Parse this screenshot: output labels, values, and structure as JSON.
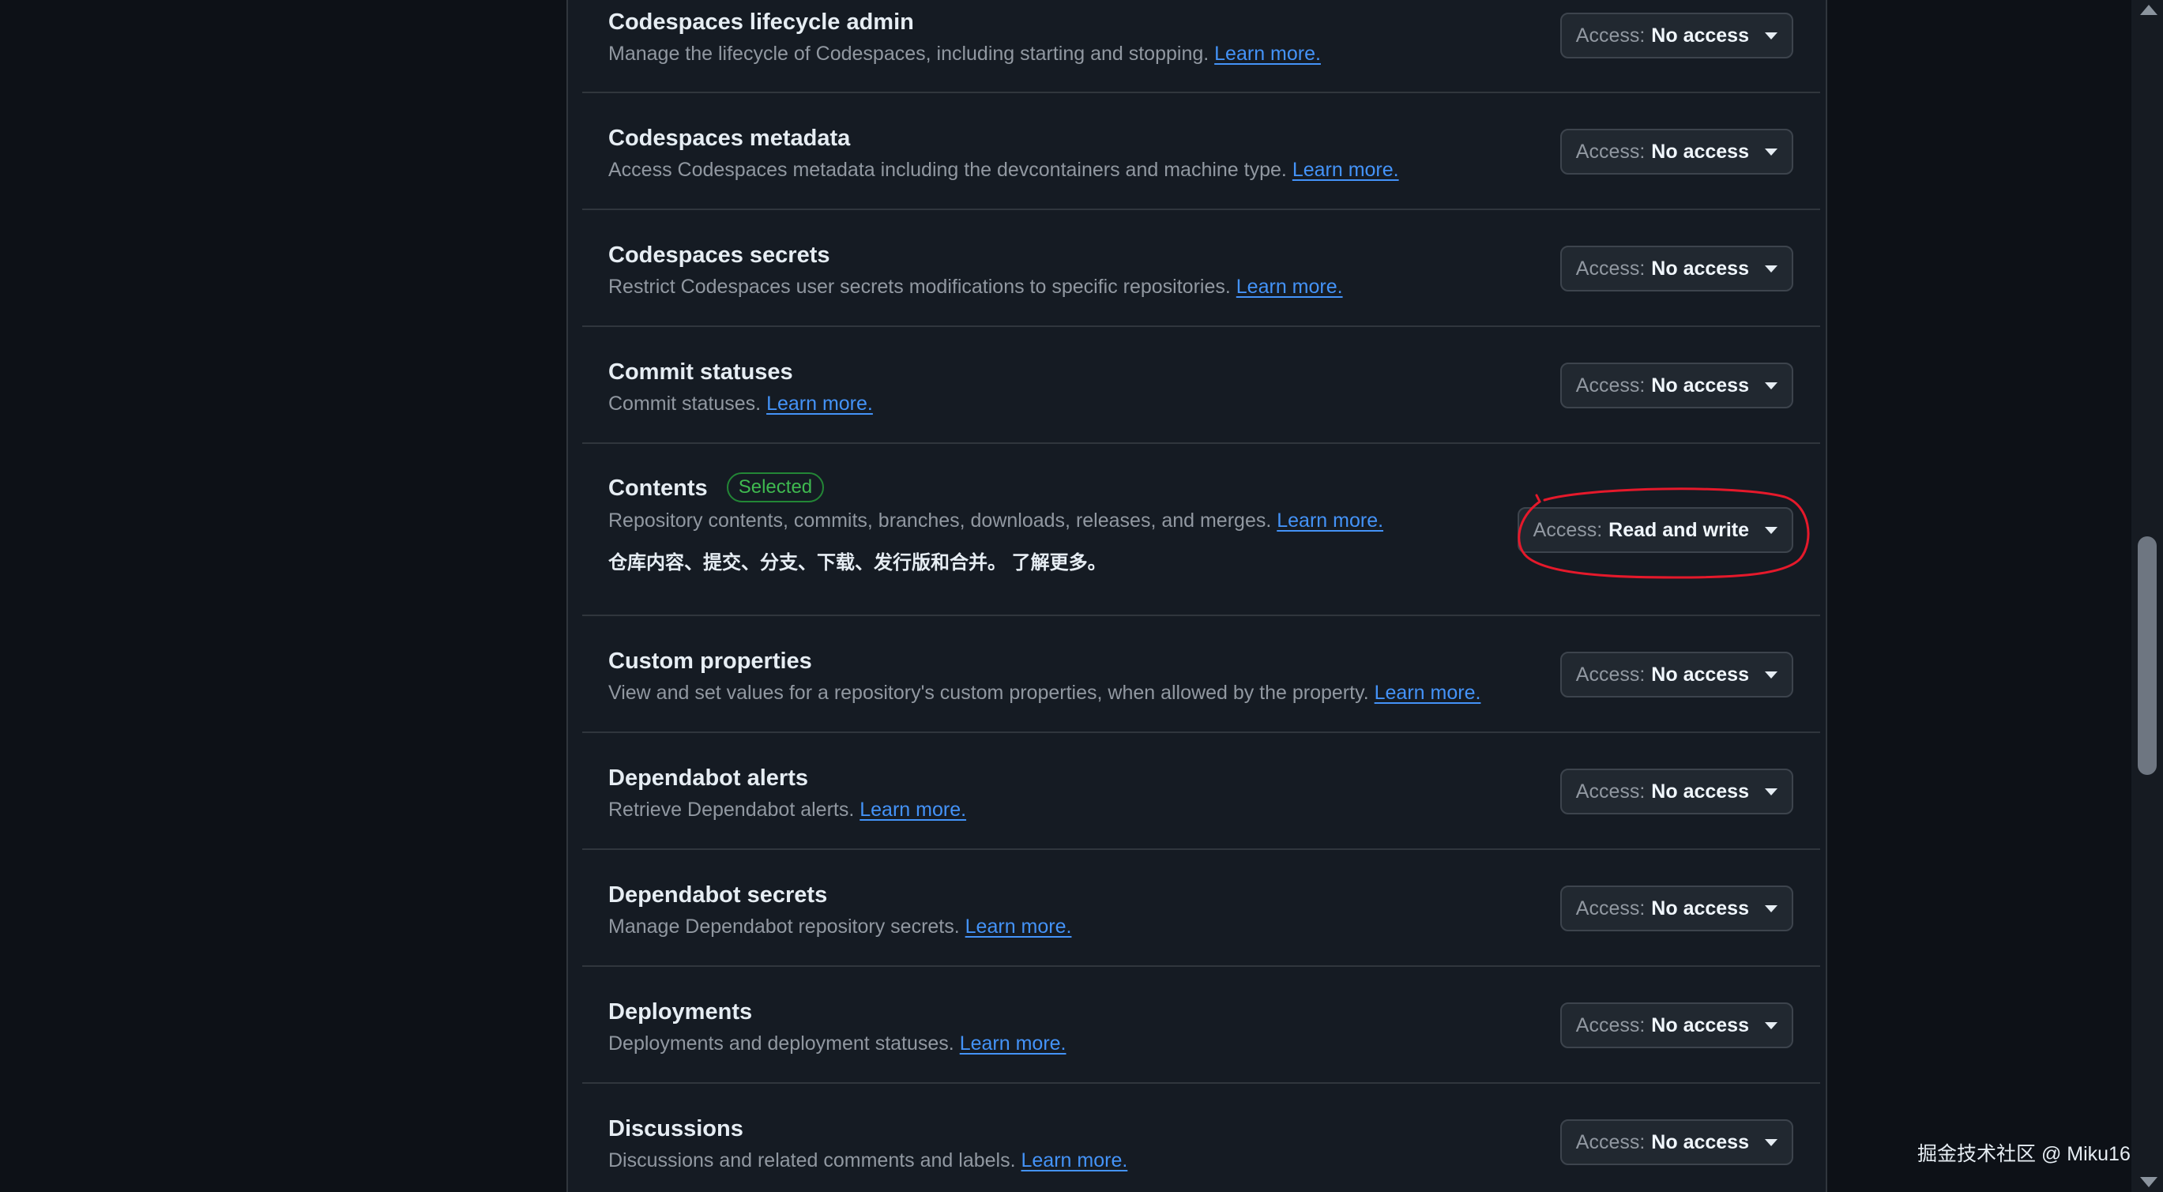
{
  "rows": [
    {
      "title": "Codespaces lifecycle admin",
      "desc": "Manage the lifecycle of Codespaces, including starting and stopping.",
      "link": "Learn more.",
      "access_prefix": "Access:",
      "access_value": "No access"
    },
    {
      "title": "Codespaces metadata",
      "desc": "Access Codespaces metadata including the devcontainers and machine type.",
      "link": "Learn more.",
      "access_prefix": "Access:",
      "access_value": "No access"
    },
    {
      "title": "Codespaces secrets",
      "desc": "Restrict Codespaces user secrets modifications to specific repositories.",
      "link": "Learn more.",
      "access_prefix": "Access:",
      "access_value": "No access"
    },
    {
      "title": "Commit statuses",
      "desc": "Commit statuses.",
      "link": "Learn more.",
      "access_prefix": "Access:",
      "access_value": "No access"
    },
    {
      "title": "Contents",
      "badge": "Selected",
      "desc": "Repository contents, commits, branches, downloads, releases, and merges.",
      "link": "Learn more.",
      "extra": "仓库内容、提交、分支、下载、发行版和合并。 了解更多。",
      "access_prefix": "Access:",
      "access_value": "Read and write"
    },
    {
      "title": "Custom properties",
      "desc": "View and set values for a repository's custom properties, when allowed by the property.",
      "link": "Learn more.",
      "access_prefix": "Access:",
      "access_value": "No access"
    },
    {
      "title": "Dependabot alerts",
      "desc": "Retrieve Dependabot alerts.",
      "link": "Learn more.",
      "access_prefix": "Access:",
      "access_value": "No access"
    },
    {
      "title": "Dependabot secrets",
      "desc": "Manage Dependabot repository secrets.",
      "link": "Learn more.",
      "access_prefix": "Access:",
      "access_value": "No access"
    },
    {
      "title": "Deployments",
      "desc": "Deployments and deployment statuses.",
      "link": "Learn more.",
      "access_prefix": "Access:",
      "access_value": "No access"
    },
    {
      "title": "Discussions",
      "desc": "Discussions and related comments and labels.",
      "link": "Learn more.",
      "access_prefix": "Access:",
      "access_value": "No access"
    }
  ],
  "colors": {
    "page_bg": "#0d1117",
    "panel_bg": "#151b23",
    "link": "#4493f8",
    "badge_green": "#3fb950",
    "annotation_red": "#e5192b"
  },
  "watermark": "掘金技术社区 @ Miku16"
}
